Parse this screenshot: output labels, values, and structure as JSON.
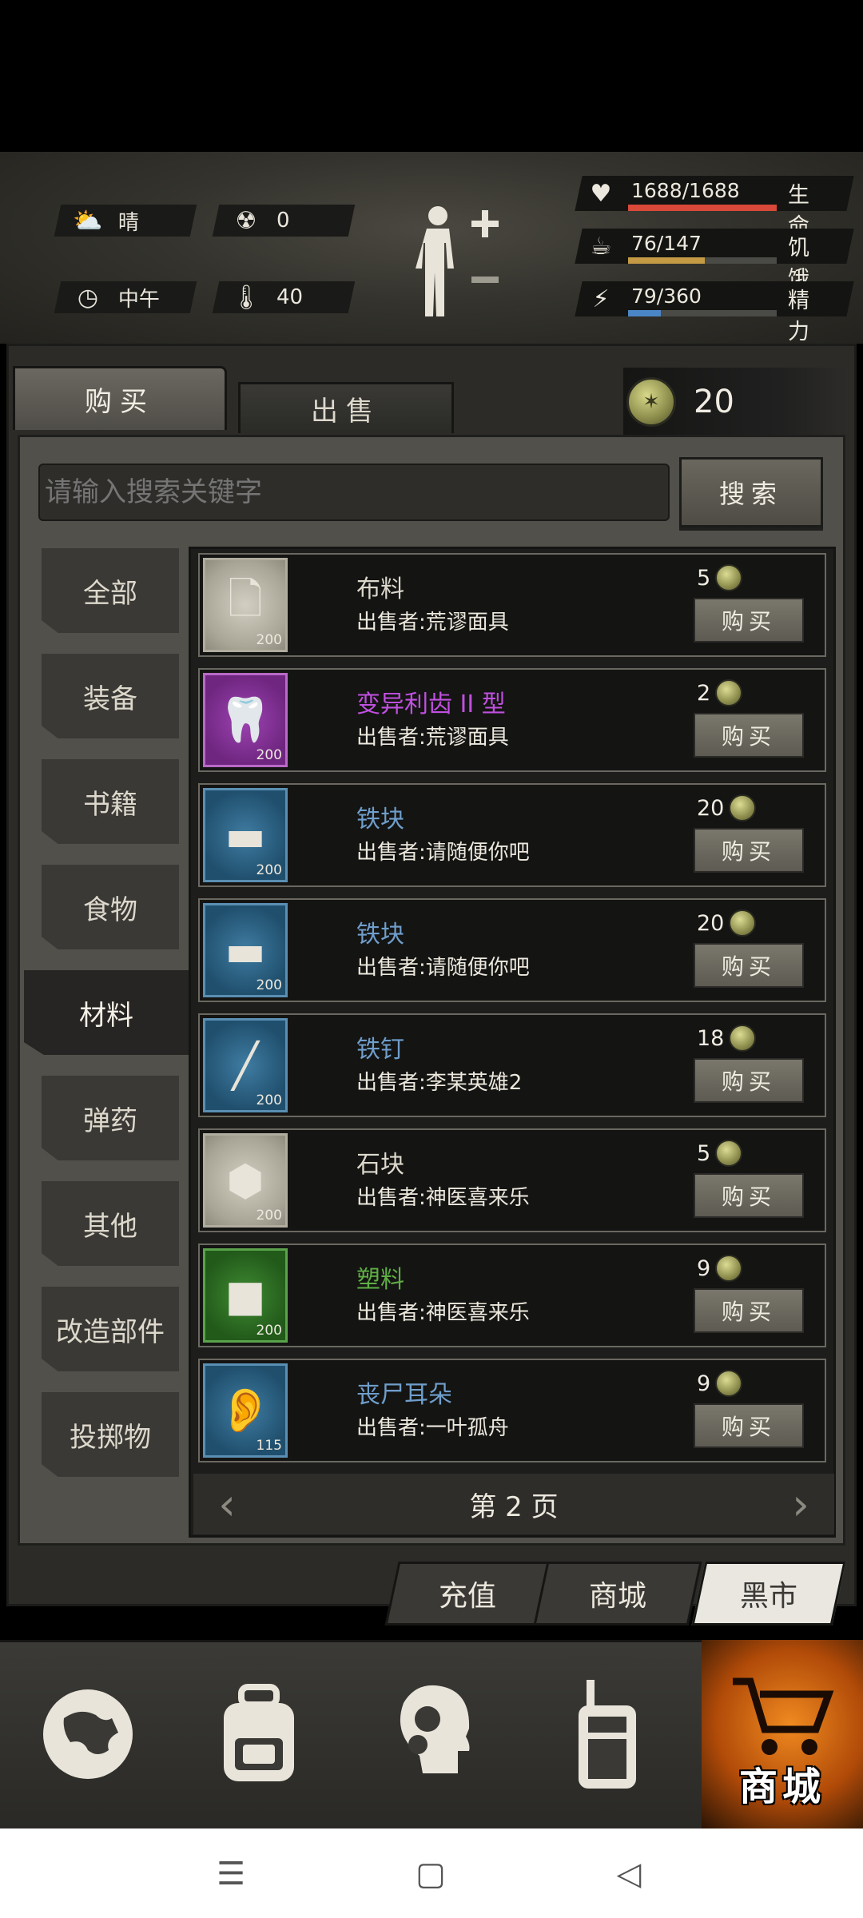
{
  "env": {
    "weather": "晴",
    "radiation": "0",
    "time": "中午",
    "temperature": "40"
  },
  "vitals": [
    {
      "value": "1688/1688",
      "label": "生命",
      "fill": 1.0,
      "color": "#d9493a"
    },
    {
      "value": "76/147",
      "label": "饥饿",
      "fill": 0.517,
      "color": "#c49a44"
    },
    {
      "value": "79/360",
      "label": "精力",
      "fill": 0.219,
      "color": "#4a86c5"
    }
  ],
  "tabs": {
    "buy": "购买",
    "sell": "出售"
  },
  "currency": "20",
  "search": {
    "placeholder": "请输入搜索关键字",
    "button": "搜索"
  },
  "categories": [
    "全部",
    "装备",
    "书籍",
    "食物",
    "材料",
    "弹药",
    "其他",
    "改造部件",
    "投掷物"
  ],
  "active_category": "材料",
  "items": [
    {
      "name": "布料",
      "seller": "出售者:荒谬面具",
      "price": "5",
      "qty": "200",
      "name_color": "#dcd8cc",
      "icon": "cloth-icon",
      "bg": "gray"
    },
    {
      "name": "变异利齿 II 型",
      "seller": "出售者:荒谬面具",
      "price": "2",
      "qty": "200",
      "name_color": "#c050e0",
      "icon": "mutant-fang-icon",
      "bg": "purple"
    },
    {
      "name": "铁块",
      "seller": "出售者:请随便你吧",
      "price": "20",
      "qty": "200",
      "name_color": "#6f9ecb",
      "icon": "iron-ingot-icon",
      "bg": "blue"
    },
    {
      "name": "铁块",
      "seller": "出售者:请随便你吧",
      "price": "20",
      "qty": "200",
      "name_color": "#6f9ecb",
      "icon": "iron-ingot-icon",
      "bg": "blue"
    },
    {
      "name": "铁钉",
      "seller": "出售者:李某英雄2",
      "price": "18",
      "qty": "200",
      "name_color": "#6f9ecb",
      "icon": "iron-nail-icon",
      "bg": "blue"
    },
    {
      "name": "石块",
      "seller": "出售者:神医喜来乐",
      "price": "5",
      "qty": "200",
      "name_color": "#dcd8cc",
      "icon": "stone-icon",
      "bg": "gray"
    },
    {
      "name": "塑料",
      "seller": "出售者:神医喜来乐",
      "price": "9",
      "qty": "200",
      "name_color": "#5fae44",
      "icon": "plastic-icon",
      "bg": "green"
    },
    {
      "name": "丧尸耳朵",
      "seller": "出售者:一叶孤舟",
      "price": "9",
      "qty": "115",
      "name_color": "#6f9ecb",
      "icon": "zombie-ear-icon",
      "bg": "blue"
    }
  ],
  "buy_label": "购买",
  "pager": {
    "text": "第 2 页"
  },
  "shop_tabs": [
    "充值",
    "商城",
    "黑市"
  ],
  "active_shop_tab": "黑市",
  "nav": {
    "shop_label": "商城"
  }
}
